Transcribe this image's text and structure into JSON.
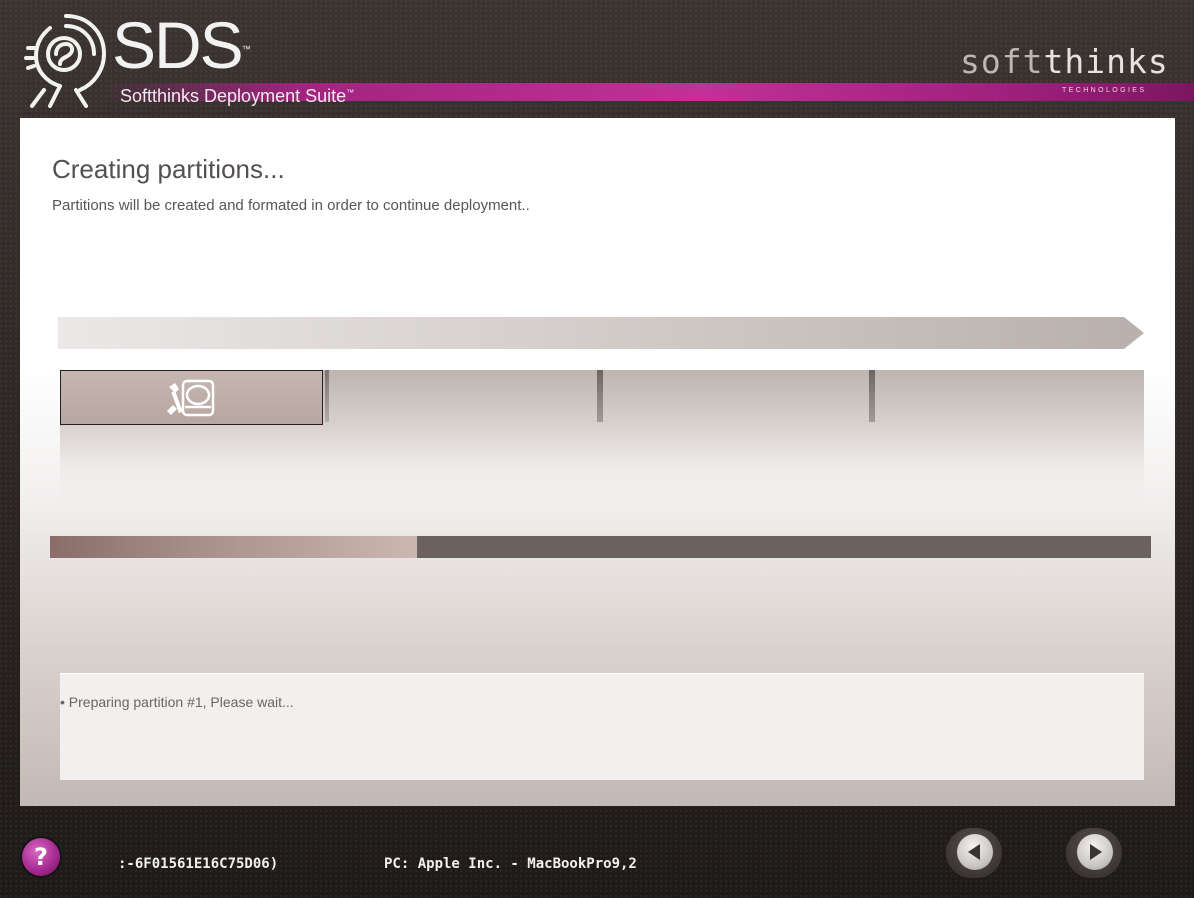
{
  "header": {
    "logo_text": "SDS",
    "logo_trademark": "™",
    "suite_label": "Softthinks Deployment Suite",
    "suite_trademark": "™",
    "brand_name_light": "soft",
    "brand_name_bold": "thinks",
    "brand_subtitle": "TECHNOLOGIES"
  },
  "main": {
    "title": "Creating partitions...",
    "subtitle": "Partitions will be created and formated in order to continue deployment..",
    "steps": [
      {
        "icon": "disk-tools-icon",
        "active": true
      },
      {
        "active": false
      },
      {
        "active": false
      },
      {
        "active": false
      }
    ],
    "progress": 0.333,
    "log_lines": [
      "• Preparing partition #1, Please wait..."
    ]
  },
  "footer": {
    "help_label": "?",
    "machine_id": ":-6F01561E16C75D06)",
    "pc_info": "PC: Apple Inc. - MacBookPro9,2",
    "back_icon": "back-arrow-icon",
    "next_icon": "next-arrow-icon"
  },
  "colors": {
    "accent_magenta": "#c23098",
    "progress_track": "#6b6260",
    "progress_fill": "#a88f8a",
    "background_dark": "#2d2624"
  }
}
